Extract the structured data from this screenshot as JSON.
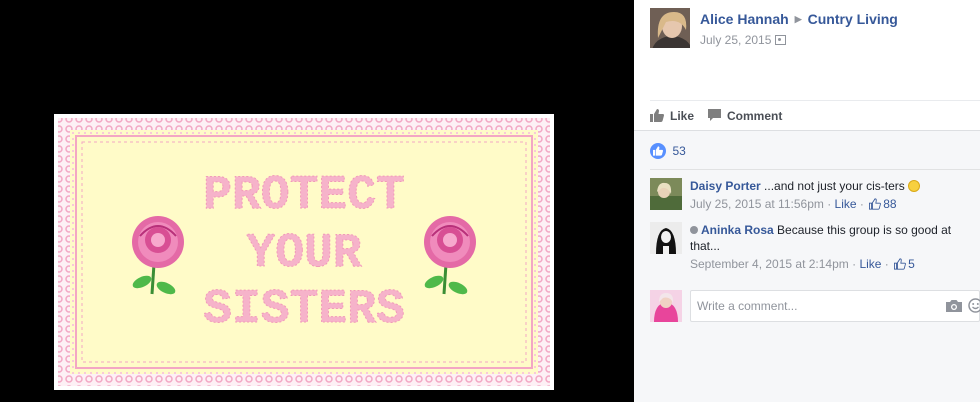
{
  "post": {
    "author": "Alice Hannah",
    "group": "Cuntry Living",
    "date": "July 25, 2015",
    "audience_icon": "group-audience-icon"
  },
  "image": {
    "line1": "PROTECT",
    "line2": "YOUR",
    "line3": "SISTERS",
    "colors": {
      "background": "#fffbc8",
      "lace": "#f3a7c4",
      "text": "#f6b3ca",
      "rose": "#e46aa6",
      "leaf": "#4fb94a"
    }
  },
  "actions": {
    "like": "Like",
    "comment": "Comment"
  },
  "reactions": {
    "count": "53"
  },
  "comments": [
    {
      "name": "Daisy Porter",
      "text": "...and not just your cis-ters",
      "time": "July 25, 2015 at 11:56pm",
      "like_label": "Like",
      "likes": "88"
    },
    {
      "name": "Aninka Rosa",
      "text": "Because this group is so good at that...",
      "time": "September 4, 2015 at 2:14pm",
      "like_label": "Like",
      "likes": "5"
    }
  ],
  "composer": {
    "placeholder": "Write a comment..."
  },
  "colors": {
    "link": "#365899",
    "meta": "#90949c",
    "like_blue": "#5890ff",
    "panel_bg": "#f6f7f9"
  }
}
